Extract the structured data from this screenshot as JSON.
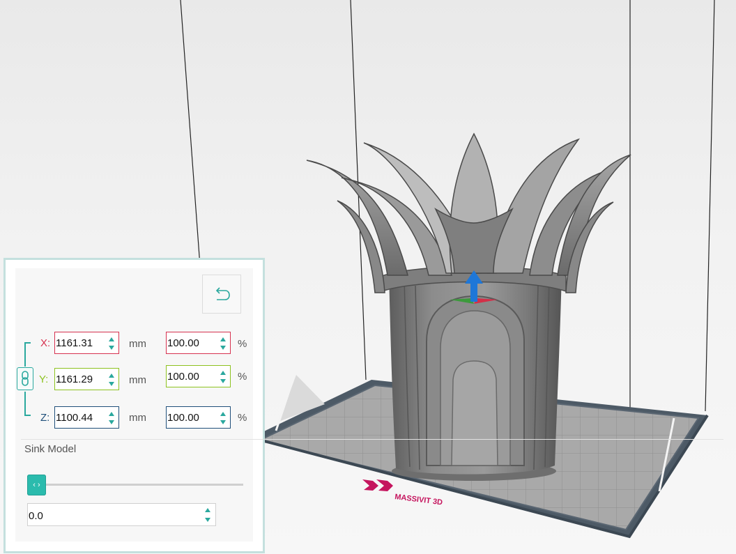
{
  "scale_panel": {
    "rows": [
      {
        "axis": "X:",
        "size_mm": "1161.31",
        "unit_mm": "mm",
        "percent": "100.00",
        "unit_pct": "%",
        "color": "#d6314f"
      },
      {
        "axis": "Y:",
        "size_mm": "1161.29",
        "unit_mm": "mm",
        "percent": "100.00",
        "unit_pct": "%",
        "color": "#8dc21f"
      },
      {
        "axis": "Z:",
        "size_mm": "1100.44",
        "unit_mm": "mm",
        "percent": "100.00",
        "unit_pct": "%",
        "color": "#1f4f7a"
      }
    ],
    "sink": {
      "label": "Sink Model",
      "value": "0.0",
      "slider_level": 0
    },
    "accent": "#2bbbad",
    "icons": [
      "reset-icon",
      "link-icon",
      "spin-up-icon",
      "spin-down-icon",
      "slider-arrows-icon"
    ]
  },
  "viewport": {
    "bed_logo_text": "MASSIVIT 3D",
    "logo_color": "#c5155e",
    "model": "crown-vase",
    "gizmo": "move-z-arrow"
  }
}
